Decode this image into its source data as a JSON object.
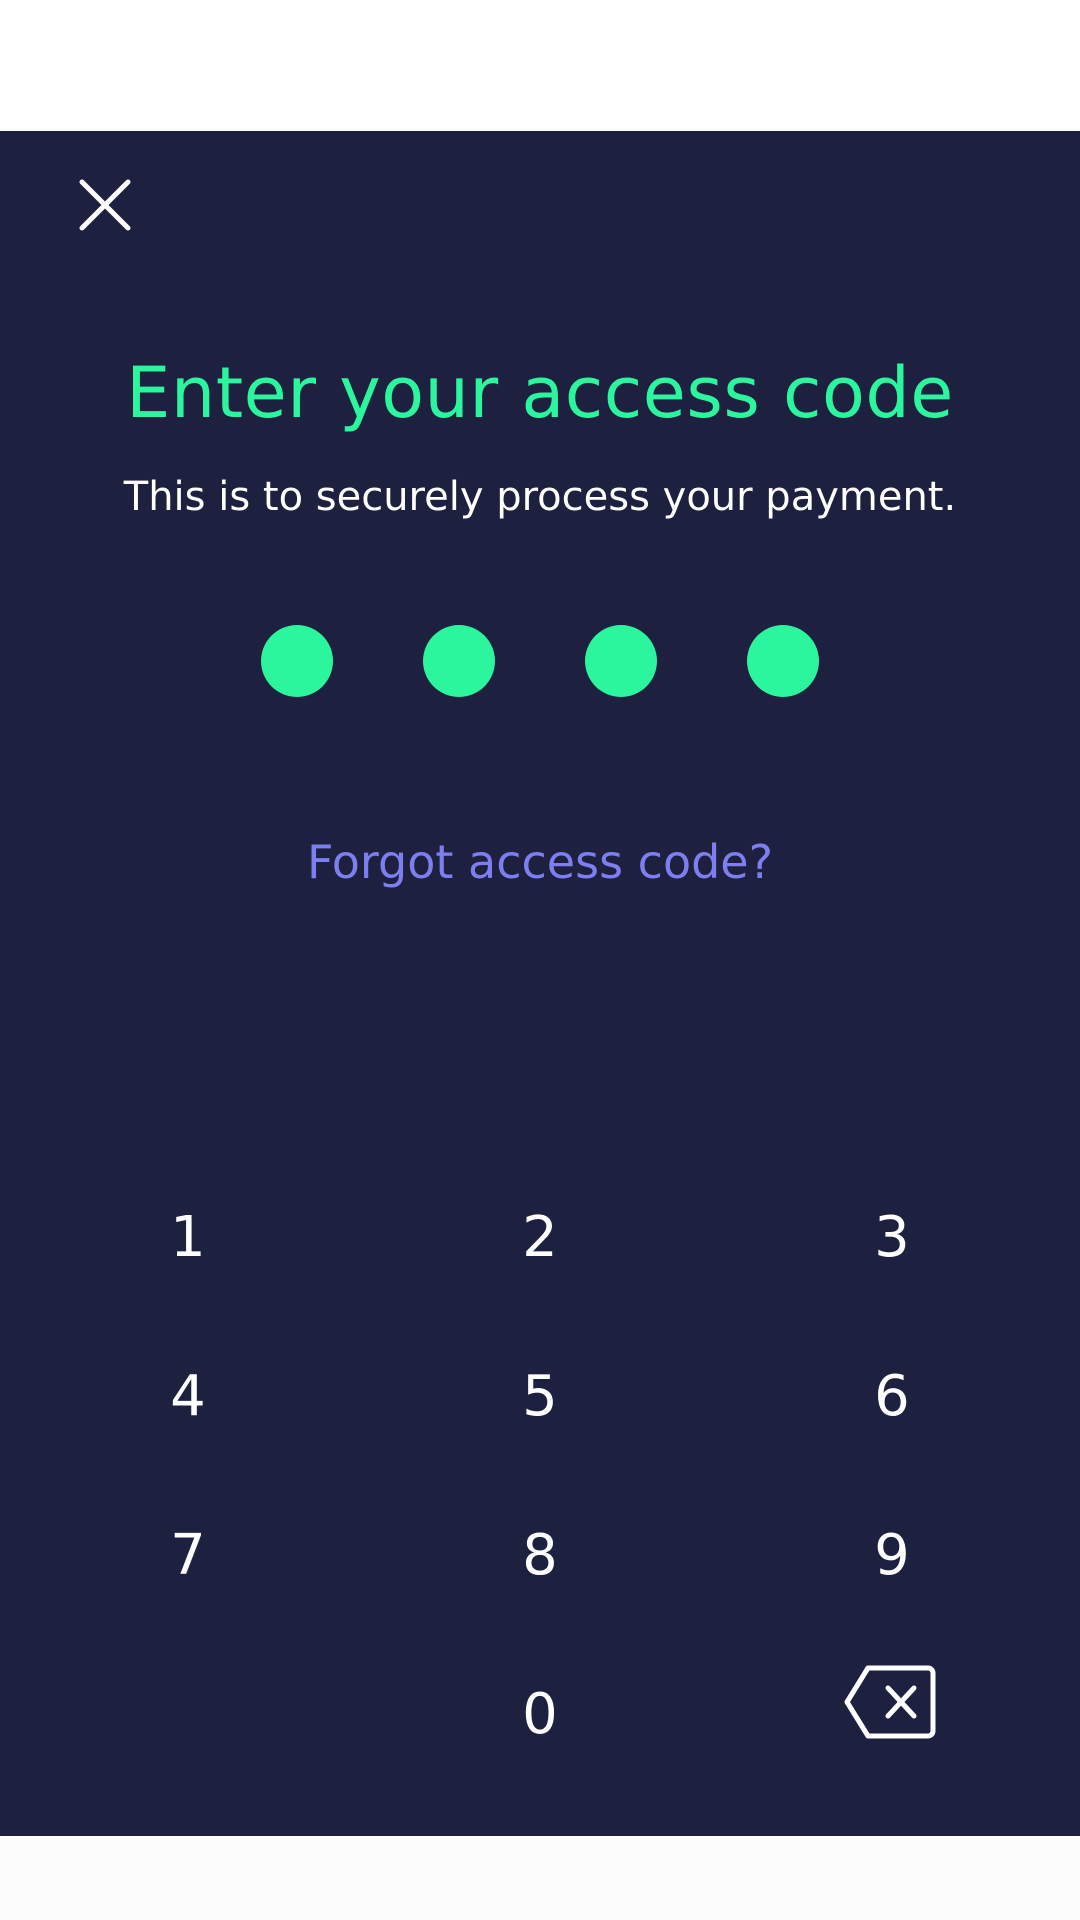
{
  "header": {
    "close_icon": "close-icon"
  },
  "title": "Enter your access code",
  "subtitle": "This is to securely process your payment.",
  "pin": {
    "length": 4,
    "filled": 4,
    "dot_color": "#2bf69d"
  },
  "forgot_link": "Forgot access code?",
  "keypad": {
    "keys": [
      "1",
      "2",
      "3",
      "4",
      "5",
      "6",
      "7",
      "8",
      "9",
      "0"
    ],
    "backspace_icon": "backspace-icon"
  },
  "colors": {
    "background": "#1e2040",
    "accent": "#2bf69d",
    "link": "#7d7ff0",
    "text": "#ffffff"
  }
}
